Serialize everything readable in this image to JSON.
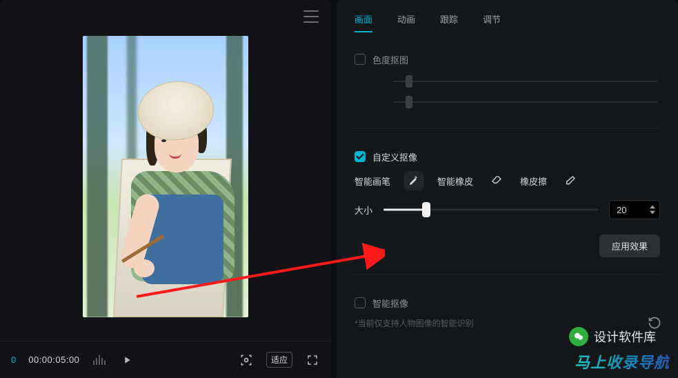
{
  "preview": {
    "frame": "0",
    "timecode": "00:00:05:00",
    "fit_label": "适应"
  },
  "tabs": {
    "items": [
      {
        "label": "画面",
        "active": true
      },
      {
        "label": "动画",
        "active": false
      },
      {
        "label": "跟踪",
        "active": false
      },
      {
        "label": "调节",
        "active": false
      }
    ]
  },
  "chroma": {
    "label": "色度抠图",
    "checked": false
  },
  "custom": {
    "label": "自定义抠像",
    "checked": true,
    "tools": {
      "smart_brush_label": "智能画笔",
      "smart_eraser_label": "智能橡皮",
      "eraser_label": "橡皮擦"
    },
    "size": {
      "label": "大小",
      "value": 20,
      "min": 0,
      "max": 100,
      "percent": 20
    },
    "apply_label": "应用效果"
  },
  "smart_matte": {
    "label": "智能抠像",
    "checked": false,
    "hint": "*当前仅支持人物图像的智能识别"
  },
  "watermark": {
    "brand": "设计软件库",
    "nav": "马上收录导航"
  },
  "colors": {
    "accent": "#00b3cc",
    "arrow": "#ff1a1a"
  }
}
